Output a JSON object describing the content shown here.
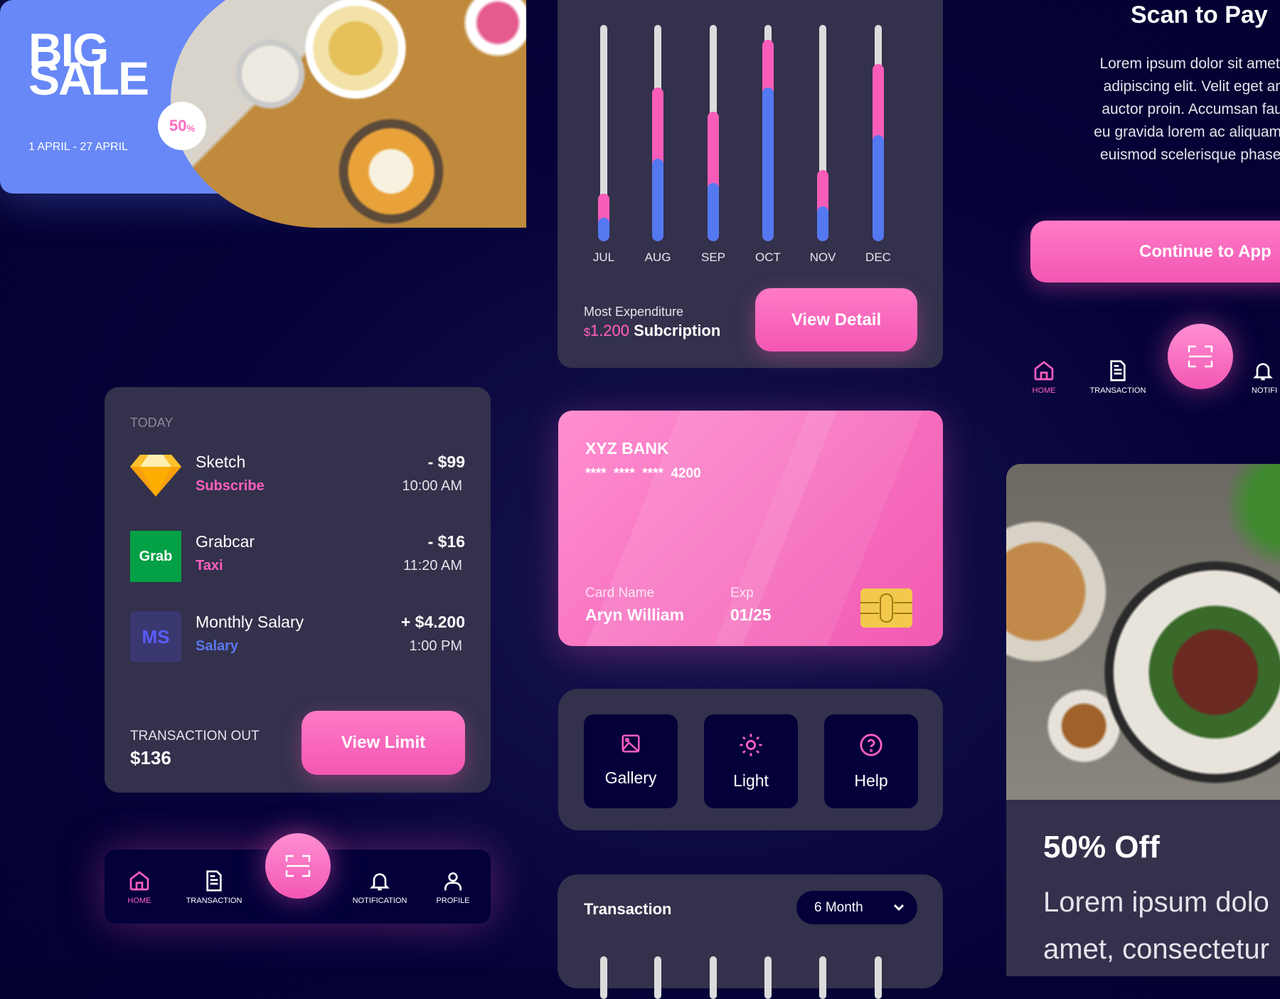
{
  "promo": {
    "line1": "BIG",
    "line2": "SALE",
    "discount": "50",
    "discount_unit": "%",
    "dates": "1 APRIL - 27 APRIL"
  },
  "today": {
    "heading": "TODAY",
    "items": [
      {
        "name": "Sketch",
        "category": "Subscribe",
        "amount": "- $99",
        "time": "10:00 AM",
        "icon": "sketch-diamond-logo",
        "category_color": "#ff5fbf"
      },
      {
        "name": "Grabcar",
        "category": "Taxi",
        "amount": "- $16",
        "time": "11:20 AM",
        "icon": "grab-logo",
        "logo_text": "Grab",
        "category_color": "#ff5fbf"
      },
      {
        "name": "Monthly Salary",
        "category": "Salary",
        "amount": "+ $4.200",
        "time": "1:00 PM",
        "icon": "ms-avatar",
        "logo_text": "MS",
        "category_color": "#5a78f0"
      }
    ],
    "out_label": "TRANSACTION OUT",
    "out_value": "$136",
    "button": "View Limit"
  },
  "nav": {
    "items": [
      {
        "label": "HOME",
        "icon": "home-icon",
        "active": true
      },
      {
        "label": "TRANSACTION",
        "icon": "document-icon"
      },
      {
        "label": "NOTIFICATION",
        "icon": "bell-icon"
      },
      {
        "label": "PROFILE",
        "icon": "user-icon"
      }
    ],
    "scan_icon": "scan-icon",
    "active_color": "#ff5fbf"
  },
  "chart_data": {
    "type": "bar",
    "stacked": true,
    "categories": [
      "JUL",
      "AUG",
      "SEP",
      "OCT",
      "NOV",
      "DEC"
    ],
    "series": [
      {
        "values": [
          0.11,
          0.38,
          0.27,
          0.71,
          0.16,
          0.49
        ],
        "color": "#5478f0"
      },
      {
        "values": [
          0.11,
          0.33,
          0.33,
          0.22,
          0.17,
          0.33
        ],
        "color": "#f85cb8"
      }
    ],
    "ylim": [
      0,
      1
    ],
    "track_color": "#dcdcdc",
    "grid": false
  },
  "expenditure": {
    "label": "Most Expenditure",
    "amount": "$1.200",
    "currency": "$",
    "amount_value": "1.200",
    "category": "Subcription",
    "button": "View Detail"
  },
  "bank_card": {
    "bank": "XYZ BANK",
    "number": "****  ****  ****  4200",
    "name_label": "Card Name",
    "name": "Aryn William",
    "exp_label": "Exp",
    "exp": "01/25"
  },
  "quick_actions": [
    {
      "label": "Gallery",
      "icon": "image-icon"
    },
    {
      "label": "Light",
      "icon": "sun-icon"
    },
    {
      "label": "Help",
      "icon": "help-circle-icon"
    }
  ],
  "transaction": {
    "title": "Transaction",
    "period": "6 Month"
  },
  "scan_page": {
    "title": "Scan to Pay",
    "body_lines": [
      "Lorem ipsum dolor sit amet, co",
      "adipiscing elit. Velit eget amet",
      "auctor proin. Accumsan faucib",
      "eu gravida lorem ac aliquam sap",
      "euismod scelerisque phasellus"
    ],
    "button": "Continue to App",
    "nav": [
      "HOME",
      "TRANSACTION",
      "NOTIFI"
    ]
  },
  "offer": {
    "title": "50% Off",
    "lines": [
      "Lorem ipsum dolo",
      "amet, consectetur"
    ]
  },
  "colors": {
    "background": "#050238",
    "card": "#33314b",
    "accent": "#f85cb8",
    "blue": "#5478f0"
  }
}
